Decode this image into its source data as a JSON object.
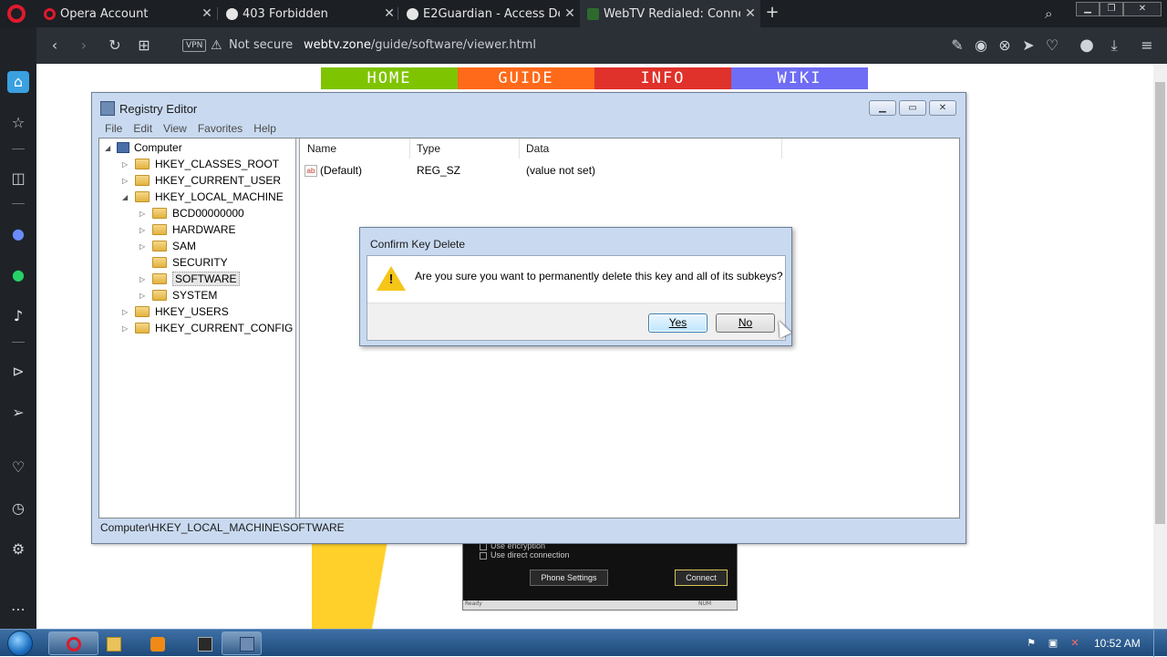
{
  "browser": {
    "tabs": [
      {
        "label": "Opera Account",
        "favicon_color": "#e0192c"
      },
      {
        "label": "403 Forbidden",
        "favicon_color": "#e6e6e6"
      },
      {
        "label": "E2Guardian - Access Denie",
        "favicon_color": "#e6e6e6"
      },
      {
        "label": "WebTV Redialed: Connecti",
        "favicon_color": "#2d6b2d"
      }
    ],
    "vpn_label": "VPN",
    "security_text": "Not secure",
    "url_domain": "webtv.zone",
    "url_path": "/guide/software/viewer.html"
  },
  "site_nav": [
    {
      "label": "HOME",
      "color": "#7fc400"
    },
    {
      "label": "GUIDE",
      "color": "#ff6a1a"
    },
    {
      "label": "INFO",
      "color": "#e0312a"
    },
    {
      "label": "WIKI",
      "color": "#6f6cf5"
    }
  ],
  "webtv_screenshot": {
    "option_1": "Use encryption",
    "option_2": "Use direct connection",
    "phone_settings_label": "Phone Settings",
    "connect_label": "Connect",
    "status_left": "Ready",
    "status_right": "NUM"
  },
  "registry": {
    "title": "Registry Editor",
    "menu": [
      "File",
      "Edit",
      "View",
      "Favorites",
      "Help"
    ],
    "tree": {
      "root": "Computer",
      "hkcr": "HKEY_CLASSES_ROOT",
      "hkcu": "HKEY_CURRENT_USER",
      "hklm": "HKEY_LOCAL_MACHINE",
      "hklm_children": [
        "BCD00000000",
        "HARDWARE",
        "SAM",
        "SECURITY",
        "SOFTWARE",
        "SYSTEM"
      ],
      "hku": "HKEY_USERS",
      "hkcc": "HKEY_CURRENT_CONFIG"
    },
    "columns": [
      "Name",
      "Type",
      "Data"
    ],
    "values": [
      {
        "name": "(Default)",
        "type": "REG_SZ",
        "data": "(value not set)"
      }
    ],
    "status_path": "Computer\\HKEY_LOCAL_MACHINE\\SOFTWARE"
  },
  "dialog": {
    "title": "Confirm Key Delete",
    "message": "Are you sure you want to permanently delete this key and all of its subkeys?",
    "yes_label": "Yes",
    "no_label": "No"
  },
  "taskbar": {
    "clock": "10:52 AM"
  }
}
